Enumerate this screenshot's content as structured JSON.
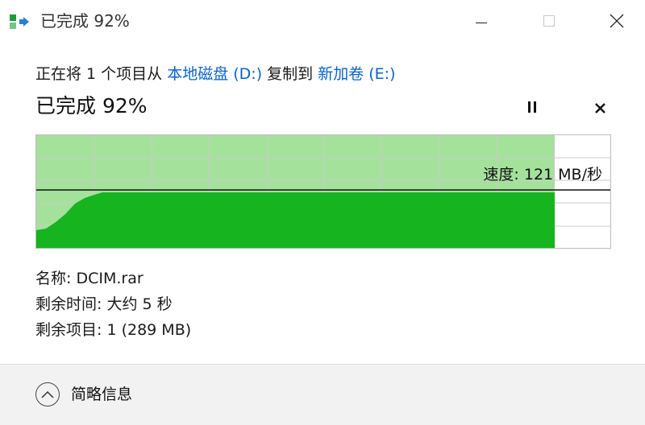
{
  "window": {
    "title": "已完成 92%",
    "icon": "copy-arrow-icon",
    "controls": [
      "minimize-icon",
      "maximize-icon",
      "close-icon"
    ]
  },
  "copy_status": {
    "prefix": "正在将 1 个项目从 ",
    "source": "本地磁盘 (D:)",
    "middle": " 复制到 ",
    "destination": "新加卷 (E:)"
  },
  "progress": {
    "title": "已完成 92%",
    "percent": 92,
    "pause_icon": "pause-icon",
    "stop_icon": "close-icon"
  },
  "graph": {
    "speed_label": "速度: 121 MB/秒",
    "fill_color_done": "#16b41e",
    "fill_color_light": "#a4e29c"
  },
  "details": {
    "name_label": "名称: ",
    "name_value": "DCIM.rar",
    "time_label": "剩余时间: ",
    "time_value": "大约 5 秒",
    "items_label": "剩余项目: ",
    "items_value": "1 (289 MB)"
  },
  "footer": {
    "toggle_label": "简略信息",
    "toggle_icon": "chevron-up-icon"
  }
}
